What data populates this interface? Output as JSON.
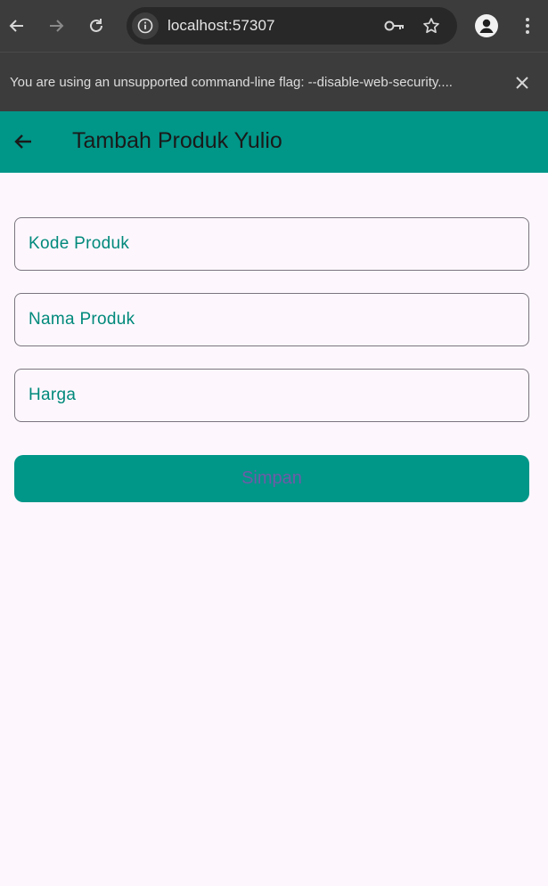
{
  "browser": {
    "url": "localhost:57307",
    "icons": [
      "back-arrow-icon",
      "forward-arrow-icon",
      "reload-icon",
      "info-icon",
      "key-icon",
      "star-icon",
      "profile-icon",
      "kebab-menu-icon"
    ]
  },
  "infobar": {
    "message": "You are using an unsupported command-line flag: --disable-web-security....",
    "icons": [
      "close-icon"
    ]
  },
  "appbar": {
    "title": "Tambah Produk Yulio",
    "background": "#009688",
    "icons": [
      "back-arrow-icon"
    ]
  },
  "form": {
    "fields": [
      {
        "label": "Kode Produk",
        "value": ""
      },
      {
        "label": "Nama Produk",
        "value": ""
      },
      {
        "label": "Harga",
        "value": ""
      }
    ],
    "submit_label": "Simpan"
  },
  "colors": {
    "accent": "#009688",
    "label_text": "#00897b",
    "button_text": "#6f5ba8",
    "page_background": "#fdf7fd"
  }
}
